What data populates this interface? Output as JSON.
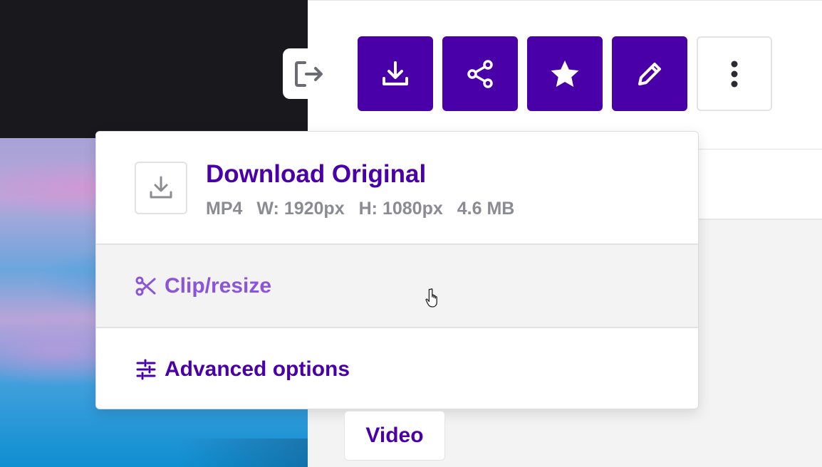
{
  "toolbar": {
    "exit_icon": "exit-icon",
    "buttons": [
      {
        "name": "download",
        "icon": "download-icon"
      },
      {
        "name": "share",
        "icon": "share-icon"
      },
      {
        "name": "favorite",
        "icon": "star-icon"
      },
      {
        "name": "edit",
        "icon": "pencil-icon"
      },
      {
        "name": "more",
        "icon": "more-vertical-icon"
      }
    ],
    "accent_color": "#4a00a8"
  },
  "dropdown": {
    "download_original": {
      "title": "Download Original",
      "format": "MP4",
      "width": "W: 1920px",
      "height": "H: 1080px",
      "size": "4.6 MB"
    },
    "clip_resize": {
      "label": "Clip/resize",
      "color": "#8a55d6"
    },
    "advanced_options": {
      "label": "Advanced options",
      "color": "#4a00a8"
    }
  },
  "chip": {
    "label": "Video"
  }
}
